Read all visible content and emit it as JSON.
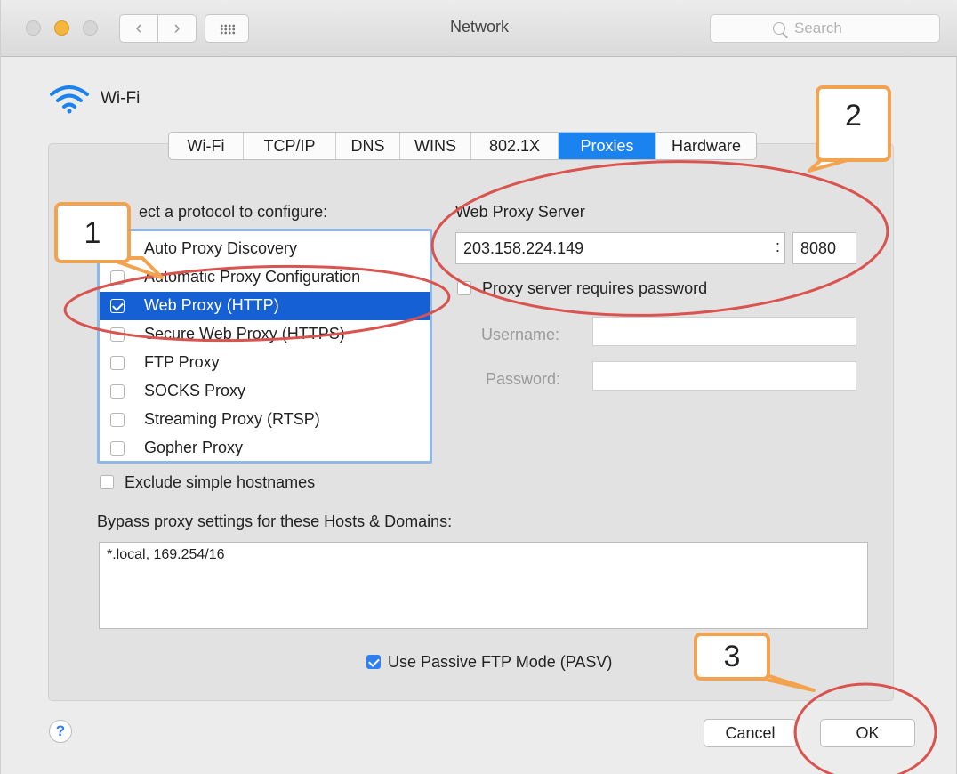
{
  "window": {
    "title": "Network",
    "search_placeholder": "Search",
    "back_glyph": "‹",
    "forward_glyph": "›"
  },
  "interface": {
    "name": "Wi-Fi",
    "icon": "wifi-icon"
  },
  "tabs": [
    {
      "label": "Wi-Fi",
      "active": false
    },
    {
      "label": "TCP/IP",
      "active": false
    },
    {
      "label": "DNS",
      "active": false
    },
    {
      "label": "WINS",
      "active": false
    },
    {
      "label": "802.1X",
      "active": false
    },
    {
      "label": "Proxies",
      "active": true
    },
    {
      "label": "Hardware",
      "active": false
    }
  ],
  "protocols": {
    "heading": "ect a protocol to configure:",
    "items": [
      {
        "label": "Auto Proxy Discovery",
        "checked": false,
        "selected": false
      },
      {
        "label": "Automatic Proxy Configuration",
        "checked": false,
        "selected": false
      },
      {
        "label": "Web Proxy (HTTP)",
        "checked": true,
        "selected": true
      },
      {
        "label": "Secure Web Proxy (HTTPS)",
        "checked": false,
        "selected": false
      },
      {
        "label": "FTP Proxy",
        "checked": false,
        "selected": false
      },
      {
        "label": "SOCKS Proxy",
        "checked": false,
        "selected": false
      },
      {
        "label": "Streaming Proxy (RTSP)",
        "checked": false,
        "selected": false
      },
      {
        "label": "Gopher Proxy",
        "checked": false,
        "selected": false
      }
    ]
  },
  "proxy_server": {
    "heading": "Web Proxy Server",
    "host": "203.158.224.149",
    "separator": ":",
    "port": "8080",
    "requires_password_label": "Proxy server requires password",
    "requires_password": false,
    "username_label": "Username:",
    "username": "",
    "password_label": "Password:",
    "password": ""
  },
  "exclude_simple_hostnames": {
    "label": "Exclude simple hostnames",
    "checked": false
  },
  "bypass": {
    "label": "Bypass proxy settings for these Hosts & Domains:",
    "value": "*.local, 169.254/16"
  },
  "passive_ftp": {
    "label": "Use Passive FTP Mode (PASV)",
    "checked": true
  },
  "buttons": {
    "help": "?",
    "cancel": "Cancel",
    "ok": "OK"
  },
  "annotations": {
    "callout_1": "1",
    "callout_2": "2",
    "callout_3": "3"
  },
  "colors": {
    "accent": "#1a83f0",
    "selection": "#1660d5",
    "callout_border": "#f3a34f",
    "annotation_circle": "#d9534f"
  }
}
